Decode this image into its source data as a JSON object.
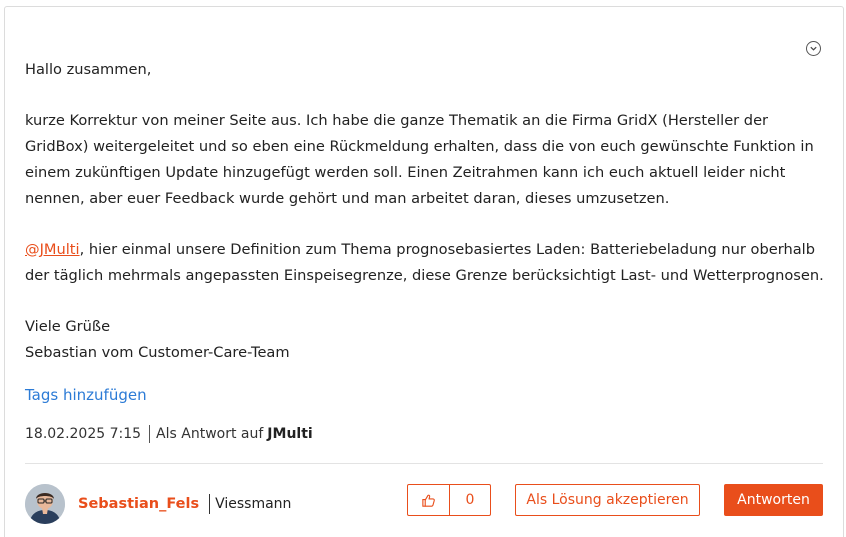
{
  "post": {
    "menu_icon": "chevron-down-circle-icon",
    "greeting": "Hallo zusammen,",
    "paragraph1": "kurze Korrektur von meiner Seite aus. Ich habe die ganze Thematik an die Firma GridX (Hersteller der GridBox) weitergeleitet und so eben eine Rückmeldung erhalten, dass die von euch gewünschte Funktion in einem zukünftigen Update hinzugefügt werden soll. Einen Zeitrahmen kann ich euch aktuell leider nicht nennen, aber euer Feedback wurde gehört und man arbeitet daran, dieses umzusetzen.",
    "mention": "@JMulti",
    "paragraph2_rest": ", hier einmal unsere Definition zum Thema prognosebasiertes Laden: Batteriebeladung nur oberhalb der täglich mehrmals angepassten Einspeisegrenze, diese Grenze berücksichtigt Last- und Wetterprognosen.",
    "sign_off": "Viele Grüße",
    "signature": "Sebastian vom Customer-Care-Team"
  },
  "tags": {
    "add_label": "Tags hinzufügen"
  },
  "meta": {
    "datetime": "18.02.2025 7:15",
    "reply_prefix": "Als Antwort auf",
    "reply_to_user": "JMulti"
  },
  "author": {
    "name": "Sebastian_Fels",
    "company": "Viessmann",
    "avatar_icon": "user-avatar"
  },
  "actions": {
    "kudos_icon": "thumbs-up-icon",
    "kudos_count": "0",
    "accept_solution_label": "Als Lösung akzeptieren",
    "reply_label": "Antworten"
  },
  "colors": {
    "accent": "#e94e1b",
    "link": "#2c7bd6",
    "text": "#222222"
  }
}
